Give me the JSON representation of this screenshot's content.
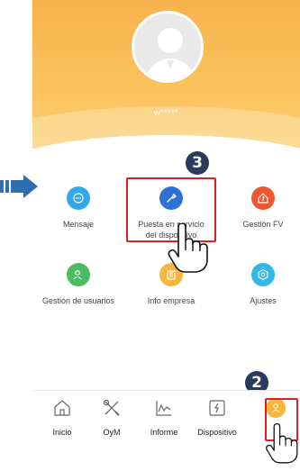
{
  "profile": {
    "username": "w*****"
  },
  "steps": {
    "step_grid": "3",
    "step_tab": "2"
  },
  "menu": [
    {
      "label": "Mensaje",
      "icon": "message-icon",
      "color": "#31a9e8"
    },
    {
      "label": "Puesta en servicio del dispositivo",
      "label_line1": "Puesta en servicio",
      "label_line2": "del dispositivo",
      "icon": "commissioning-icon",
      "color": "#2f6fd6"
    },
    {
      "label": "Gestión FV",
      "icon": "pv-management-icon",
      "color": "#f0562d"
    },
    {
      "label": "Gestión de usuarios",
      "icon": "user-management-icon",
      "color": "#4cbc62"
    },
    {
      "label": "Info empresa",
      "icon": "company-info-icon",
      "color": "#f5b63d"
    },
    {
      "label": "Ajustes",
      "icon": "settings-icon",
      "color": "#32b9e6"
    }
  ],
  "tabs": [
    {
      "label": "Inicio",
      "icon": "home-icon"
    },
    {
      "label": "OyM",
      "icon": "tools-icon"
    },
    {
      "label": "Informe",
      "icon": "report-icon"
    },
    {
      "label": "Dispositivo",
      "icon": "device-icon"
    },
    {
      "label": "",
      "icon": "profile-icon",
      "active": true
    }
  ],
  "colors": {
    "accent_orange": "#f7b24c",
    "highlight_red": "#e02020",
    "badge_navy": "#2a3a5c",
    "arrow_blue": "#2f6fb0"
  }
}
